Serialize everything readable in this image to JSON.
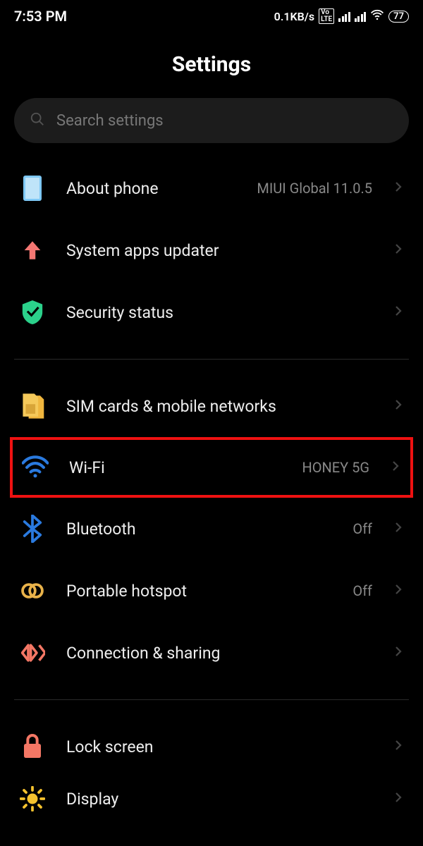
{
  "status": {
    "time": "7:53 PM",
    "net_speed": "0.1KB/s",
    "battery": "77"
  },
  "title": "Settings",
  "search": {
    "placeholder": "Search settings"
  },
  "sections": [
    {
      "items": [
        {
          "id": "about-phone",
          "label": "About phone",
          "value": "MIUI Global 11.0.5"
        },
        {
          "id": "system-apps-updater",
          "label": "System apps updater",
          "value": ""
        },
        {
          "id": "security-status",
          "label": "Security status",
          "value": ""
        }
      ]
    },
    {
      "items": [
        {
          "id": "sim-cards",
          "label": "SIM cards & mobile networks",
          "value": ""
        },
        {
          "id": "wifi",
          "label": "Wi-Fi",
          "value": "HONEY 5G",
          "highlighted": true
        },
        {
          "id": "bluetooth",
          "label": "Bluetooth",
          "value": "Off"
        },
        {
          "id": "portable-hotspot",
          "label": "Portable hotspot",
          "value": "Off"
        },
        {
          "id": "connection-sharing",
          "label": "Connection & sharing",
          "value": ""
        }
      ]
    },
    {
      "items": [
        {
          "id": "lock-screen",
          "label": "Lock screen",
          "value": ""
        },
        {
          "id": "display",
          "label": "Display",
          "value": ""
        }
      ]
    }
  ]
}
